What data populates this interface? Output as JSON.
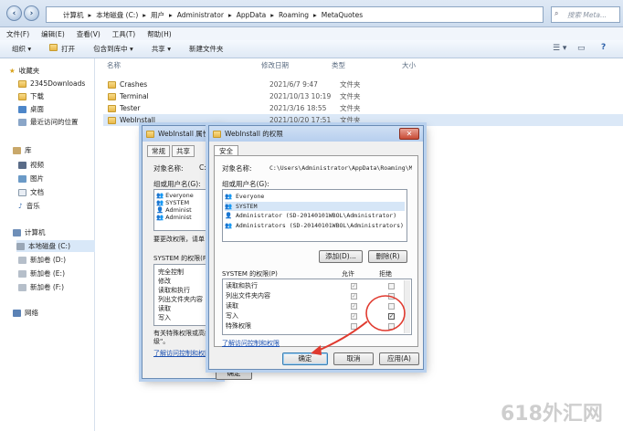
{
  "address": {
    "parts": [
      "计算机",
      "本地磁盘 (C:)",
      "用户",
      "Administrator",
      "AppData",
      "Roaming",
      "MetaQuotes"
    ],
    "search_placeholder": "搜索 Meta..."
  },
  "menu": [
    "文件(F)",
    "编辑(E)",
    "查看(V)",
    "工具(T)",
    "帮助(H)"
  ],
  "toolbar": {
    "organize": "组织",
    "open": "打开",
    "include": "包含到库中",
    "share": "共享",
    "new_folder": "新建文件夹"
  },
  "sidebar": {
    "favorites": "收藏夹",
    "fav_items": [
      "2345Downloads",
      "下载",
      "桌面",
      "最近访问的位置"
    ],
    "libraries": "库",
    "lib_items": [
      "视频",
      "图片",
      "文档",
      "音乐"
    ],
    "computer": "计算机",
    "drives": [
      "本地磁盘 (C:)",
      "新加卷 (D:)",
      "新加卷 (E:)",
      "新加卷 (F:)"
    ],
    "network": "网络"
  },
  "columns": {
    "name": "名称",
    "date": "修改日期",
    "type": "类型",
    "size": "大小"
  },
  "files": [
    {
      "name": "Crashes",
      "date": "2021/6/7 9:47",
      "type": "文件夹"
    },
    {
      "name": "Terminal",
      "date": "2021/10/13 10:19",
      "type": "文件夹"
    },
    {
      "name": "Tester",
      "date": "2021/3/16 18:55",
      "type": "文件夹"
    },
    {
      "name": "WebInstall",
      "date": "2021/10/20 17:51",
      "type": "文件夹"
    }
  ],
  "props_dialog": {
    "title": "WebInstall 属性",
    "tabs": [
      "常规",
      "共享"
    ],
    "object_label": "对象名称:",
    "object_value": "C:",
    "group_label": "组或用户名(G):",
    "users": [
      "Everyone",
      "SYSTEM",
      "Administ",
      "Administ"
    ],
    "change_text": "要更改权限，请单",
    "perm_label": "SYSTEM 的权限(P)",
    "perms": [
      "完全控制",
      "修改",
      "读取和执行",
      "列出文件夹内容",
      "读取",
      "写入"
    ],
    "special_text": "有关特殊权限或高级",
    "special_text2": "级\"。",
    "link": "了解访问控制和权限",
    "ok": "确定"
  },
  "perm_dialog": {
    "title": "WebInstall 的权限",
    "tab": "安全",
    "object_label": "对象名称:",
    "object_path": "C:\\Users\\Administrator\\AppData\\Roaming\\M",
    "group_label": "组或用户名(G):",
    "users": [
      "Everyone",
      "SYSTEM",
      "Administrator (SD-20140101WBOL\\Administrator)",
      "Administrators (SD-20140101WBOL\\Administrators)"
    ],
    "add": "添加(D)...",
    "remove": "删除(R)",
    "perm_label": "SYSTEM 的权限(P)",
    "allow": "允许",
    "deny": "拒绝",
    "perms": [
      {
        "name": "读取和执行",
        "allow": true,
        "deny": false
      },
      {
        "name": "列出文件夹内容",
        "allow": true,
        "deny": false
      },
      {
        "name": "读取",
        "allow": true,
        "deny": false
      },
      {
        "name": "写入",
        "allow": true,
        "deny": true
      },
      {
        "name": "特殊权限",
        "allow": false,
        "deny": false
      }
    ],
    "link": "了解访问控制和权限",
    "ok": "确定",
    "cancel": "取消",
    "apply": "应用(A)"
  },
  "watermark": "618外汇网",
  "colors": {
    "highlight_red": "#e03a2f",
    "link": "#1a4fb0",
    "window_blue": "#b9d1ee"
  }
}
